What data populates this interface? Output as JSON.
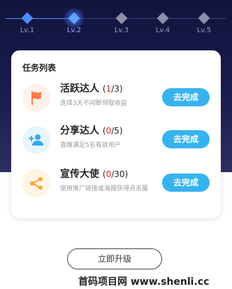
{
  "levels": [
    {
      "label": "Lv.1",
      "state": "done"
    },
    {
      "label": "Lv.2",
      "state": "current"
    },
    {
      "label": "Lv.3",
      "state": "locked"
    },
    {
      "label": "Lv.4",
      "state": "locked"
    },
    {
      "label": "Lv.5",
      "state": "locked"
    }
  ],
  "task_list": {
    "title": "任务列表",
    "tasks": [
      {
        "name": "活跃达人",
        "progress_open": "(",
        "current": "1",
        "separator": "/",
        "total": "3",
        "progress_close": ")",
        "desc": "连续3天不间断领取收益",
        "button": "去完成",
        "icon": "flag-icon",
        "icon_color": "#ff7a45",
        "icon_bg": "#fff1ea"
      },
      {
        "name": "分享达人",
        "progress_open": "(",
        "current": "0",
        "separator": "/",
        "total": "5",
        "progress_close": ")",
        "desc": "直推满足5名有效用户",
        "button": "去完成",
        "icon": "add-user-icon",
        "icon_color": "#33aaf0",
        "icon_bg": "#e7f5fe"
      },
      {
        "name": "宣传大使",
        "progress_open": "(",
        "current": "0",
        "separator": "/",
        "total": "30",
        "progress_close": ")",
        "desc": "使用推广链接或海报获得点击量",
        "button": "去完成",
        "icon": "share-icon",
        "icon_color": "#ffa531",
        "icon_bg": "#fff4e4"
      }
    ]
  },
  "upgrade_button": "立即升级",
  "watermark": "首码项目网 www.shenli.cc",
  "colors": {
    "accent_blue": "#36b3ee",
    "progress_red": "#e02020",
    "hero_dark": "#11143c"
  }
}
